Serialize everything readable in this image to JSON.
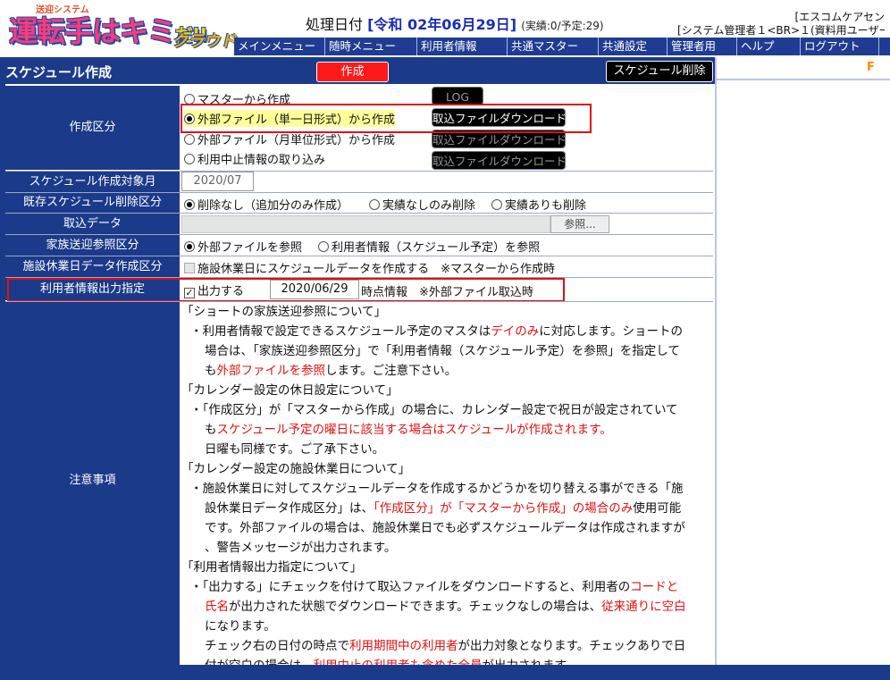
{
  "header": {
    "logo_sub": "送迎システム",
    "logo_main": "運転手はキミ",
    "logo_dane": "だ!!",
    "logo_cloud": "クラウド",
    "proc_label": "処理日付",
    "proc_date": "[令和 02年06月29日]",
    "proc_status": "(実績:0/予定:29)",
    "company": "[エスコムケアセン",
    "user": "[システム管理者１<BR>１(資料用ユーザー"
  },
  "menu": [
    "メインメニュー",
    "随時メニュー",
    "利用者情報",
    "共通マスター",
    "共通設定",
    "管理者用",
    "ヘルプ",
    "ログアウト"
  ],
  "title": "スケジュール作成",
  "buttons": {
    "create": "作成",
    "delete": "スケジュール削除",
    "log": "LOG",
    "download": "取込ファイルダウンロード",
    "browse": "参照..."
  },
  "right_mark": "F",
  "form": {
    "create_type": {
      "label": "作成区分",
      "opt1": "マスターから作成",
      "opt2": "外部ファイル（単一日形式）から作成",
      "opt3": "外部ファイル（月単位形式）から作成",
      "opt4": "利用中止情報の取り込み"
    },
    "target_month": {
      "label": "スケジュール作成対象月",
      "value": "2020/07"
    },
    "delete_type": {
      "label": "既存スケジュール削除区分",
      "opt1": "削除なし（追加分のみ作成）",
      "opt2": "実績なしのみ削除",
      "opt3": "実績ありも削除"
    },
    "import_data": {
      "label": "取込データ"
    },
    "family_ref": {
      "label": "家族送迎参照区分",
      "opt1": "外部ファイルを参照",
      "opt2": "利用者情報（スケジュール予定）を参照"
    },
    "holiday_data": {
      "label": "施設休業日データ作成区分",
      "text": "施設休業日にスケジュールデータを作成する　※マスターから作成時"
    },
    "user_output": {
      "label": "利用者情報出力指定",
      "check_label": "出力する",
      "date": "2020/06/29",
      "suffix": "時点情報　※外部ファイル取込時"
    },
    "notes_label": "注意事項"
  },
  "notes": {
    "l1": "「ショートの家族送迎参照について」",
    "l2a": "・利用者情報で設定できるスケジュール予定のマスタは",
    "l2r": "デイのみ",
    "l2b": "に対応します。ショートの",
    "l3": "場合は、「家族送迎参照区分」で「利用者情報（スケジュール予定）を参照」を指定して",
    "l4a": "も",
    "l4r": "外部ファイルを参照",
    "l4b": "します。ご注意下さい。",
    "l5": "「カレンダー設定の休日設定について」",
    "l6": "・「作成区分」が「マスターから作成」の場合に、カレンダー設定で祝日が設定されていて",
    "l7a": "も",
    "l7r": "スケジュール予定の曜日に該当する場合はスケジュールが作成されます。",
    "l8": "日曜も同様です。ご了承下さい。",
    "l9": "「カレンダー設定の施設休業日について」",
    "l10": "・施設休業日に対してスケジュールデータを作成するかどうかを切り替える事ができる「施",
    "l11a": "設休業日データ作成区分」は、",
    "l11r": "「作成区分」が「マスターから作成」の場合のみ",
    "l11b": "使用可能",
    "l12": "です。外部ファイルの場合は、施設休業日でも必ずスケジュールデータは作成されますが",
    "l13": "、警告メッセージが出力されます。",
    "l14": "「利用者情報出力指定について」",
    "l15a": "・「出力する」にチェックを付けて取込ファイルをダウンロードすると、利用者の",
    "l15r": "コードと",
    "l16r": "氏名",
    "l16b": "が出力された状態でダウンロードできます。チェックなしの場合は、",
    "l16r2": "従来通りに空白",
    "l17": "になります。",
    "l18a": "チェック右の日付の時点で",
    "l18r": "利用期間中の利用者",
    "l18b": "が出力対象となります。チェックありで日",
    "l19a": "付が空白の場合は、",
    "l19r": "利用中止の利用者も含めた全員",
    "l19b": "が出力されます。"
  },
  "colors": {
    "navy": "#1c3a8a",
    "menu": "#1f3c92",
    "accent_red": "#e01010",
    "highlight": "#ffff99"
  }
}
